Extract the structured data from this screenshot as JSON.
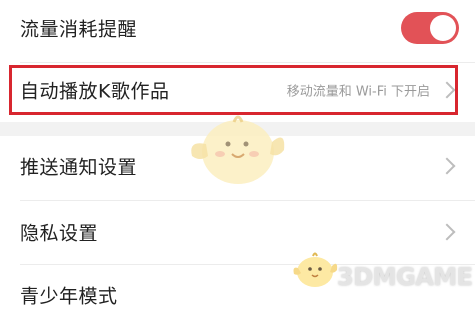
{
  "settings": {
    "traffic_reminder": {
      "label": "流量消耗提醒",
      "enabled": true
    },
    "autoplay_k_songs": {
      "label": "自动播放K歌作品",
      "value": "移动流量和 Wi-Fi 下开启"
    },
    "push_notifications": {
      "label": "推送通知设置"
    },
    "privacy": {
      "label": "隐私设置"
    },
    "youth_mode": {
      "label": "青少年模式"
    }
  },
  "watermark": {
    "text": "3DMGAME"
  },
  "colors": {
    "toggle_on": "#e25257",
    "highlight_border": "#d8262f"
  }
}
